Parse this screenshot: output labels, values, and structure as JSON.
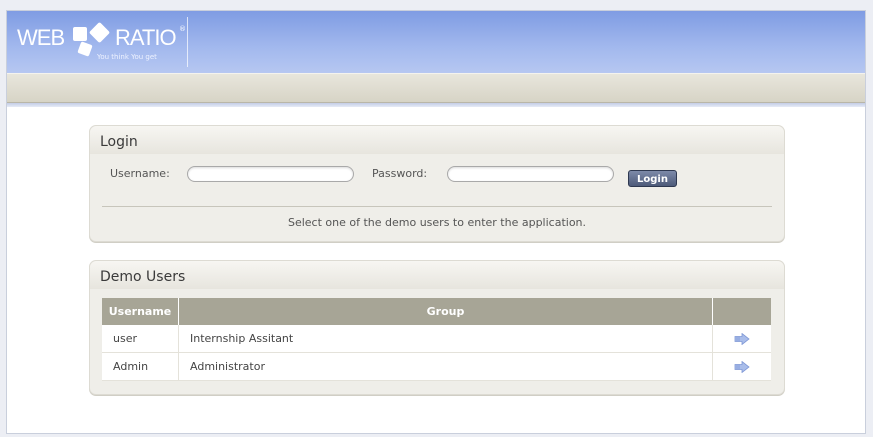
{
  "header": {
    "logo_left": "WEB",
    "logo_right": "RATIO",
    "logo_registered": "®",
    "tagline": "You think You get"
  },
  "login": {
    "title": "Login",
    "username_label": "Username:",
    "username_value": "",
    "password_label": "Password:",
    "password_value": "",
    "button_label": "Login",
    "hint": "Select one of the demo users to enter the application."
  },
  "demo_users": {
    "title": "Demo Users",
    "columns": [
      "Username",
      "Group",
      ""
    ],
    "rows": [
      {
        "username": "user",
        "group": "Internship Assitant",
        "action_icon": "arrow-right-icon"
      },
      {
        "username": "Admin",
        "group": "Administrator",
        "action_icon": "arrow-right-icon"
      }
    ]
  },
  "colors": {
    "header_blue": "#8aa5e8",
    "table_header": "#a7a596",
    "button": "#5a6785",
    "arrow": "#8fa8df"
  }
}
